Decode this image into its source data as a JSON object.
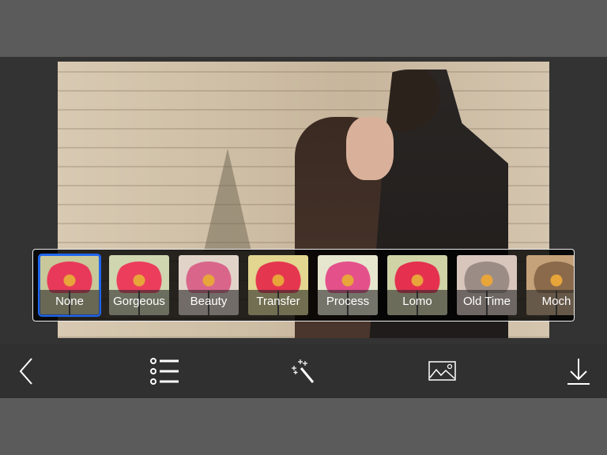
{
  "filters": [
    {
      "label": "None",
      "selected": true,
      "bg": "#c9c89a",
      "flower": "#e8395a"
    },
    {
      "label": "Gorgeous",
      "selected": false,
      "bg": "#cfd6b0",
      "flower": "#ec3d5c"
    },
    {
      "label": "Beauty",
      "selected": false,
      "bg": "#e2d3c9",
      "flower": "#d9668a"
    },
    {
      "label": "Transfer",
      "selected": false,
      "bg": "#e2d690",
      "flower": "#e5364f"
    },
    {
      "label": "Process",
      "selected": false,
      "bg": "#e6e6cf",
      "flower": "#e4508a"
    },
    {
      "label": "Lomo",
      "selected": false,
      "bg": "#cfd3a6",
      "flower": "#e5304f"
    },
    {
      "label": "Old Time",
      "selected": false,
      "bg": "#d8c6bd",
      "flower": "#9c8c86"
    },
    {
      "label": "Moch",
      "selected": false,
      "bg": "#c6a27a",
      "flower": "#8a6a4a"
    }
  ],
  "toolbar": {
    "icons": [
      "back-chevron",
      "list",
      "magic-wand",
      "image",
      "download"
    ]
  },
  "colors": {
    "selection": "#1f66f0",
    "toolbar": "#303030",
    "frame": "#5b5b5b"
  }
}
